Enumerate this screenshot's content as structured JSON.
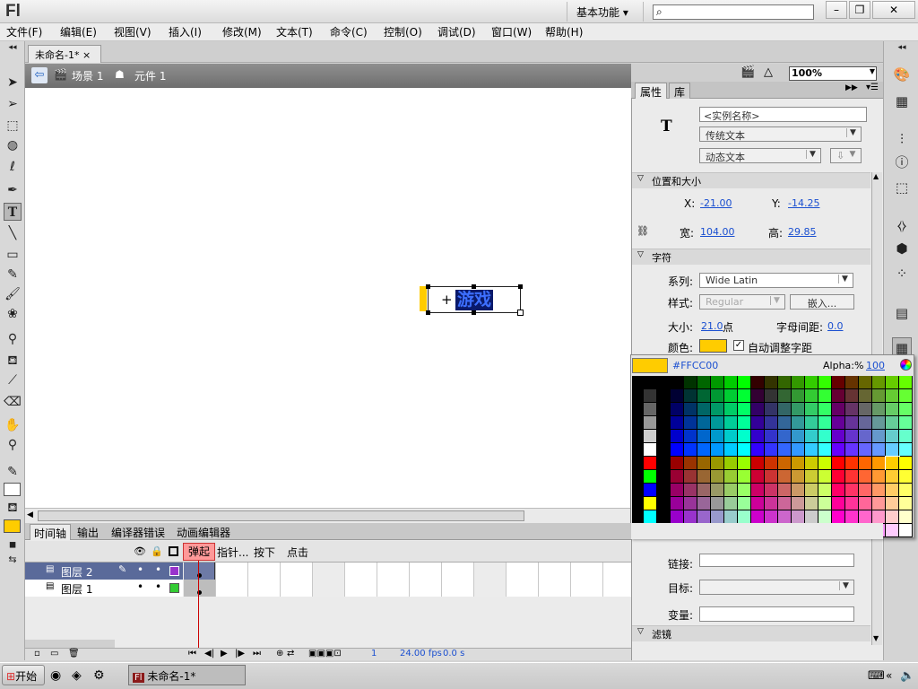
{
  "app": {
    "logo": "Fl",
    "workspace": "基本功能",
    "workspace_arrow": "▾"
  },
  "window_buttons": {
    "minimize": "–",
    "restore": "❐",
    "close": "✕"
  },
  "menu": [
    "文件(F)",
    "编辑(E)",
    "视图(V)",
    "插入(I)",
    "修改(M)",
    "文本(T)",
    "命令(C)",
    "控制(O)",
    "调试(D)",
    "窗口(W)",
    "帮助(H)"
  ],
  "document": {
    "tab_title": "未命名-1*",
    "close": "×"
  },
  "editbar": {
    "scene": "场景 1",
    "symbol": "元件 1",
    "zoom": "100%"
  },
  "stage": {
    "text": "游戏",
    "registration": "+"
  },
  "panel": {
    "tabs": [
      "属性",
      "库"
    ],
    "type_icon": "T",
    "instance_name_placeholder": "<实例名称>",
    "text_engine": "传统文本",
    "text_type": "动态文本",
    "align_dd": "⇩",
    "section_position": "位置和大小",
    "x_label": "X:",
    "x_value": "-21.00",
    "y_label": "Y:",
    "y_value": "-14.25",
    "w_label": "宽:",
    "w_value": "104.00",
    "h_label": "高:",
    "h_value": "29.85",
    "section_char": "字符",
    "family_label": "系列:",
    "family_value": "Wide Latin",
    "style_label": "样式:",
    "style_value": "Regular",
    "embed_button": "嵌入...",
    "size_label": "大小:",
    "size_value": "21.0",
    "size_unit": "点",
    "spacing_label": "字母间距:",
    "spacing_value": "0.0",
    "color_label": "颜色:",
    "auto_kern_label": "自动调整字距",
    "link_label": "链接:",
    "target_label": "目标:",
    "variable_label": "变量:",
    "section_filter": "滤镜"
  },
  "picker": {
    "hex": "#FFCC00",
    "alpha_label": "Alpha:%",
    "alpha_value": "100",
    "swatch_color": "#FFCC00"
  },
  "timeline": {
    "tabs": [
      "时间轴",
      "输出",
      "编译器错误",
      "动画编辑器"
    ],
    "frame_labels": [
      "弹起",
      "指针...",
      "按下",
      "点击"
    ],
    "layers": [
      {
        "name": "图层 2",
        "color": "#9933cc"
      },
      {
        "name": "图层 1",
        "color": "#33cc33"
      }
    ],
    "footer": {
      "frame": "1",
      "fps": "24.00 fps",
      "time": "0.0 s"
    }
  },
  "taskbar": {
    "start": "开始",
    "item": "未命名-1*",
    "item_icon": "Fl"
  }
}
